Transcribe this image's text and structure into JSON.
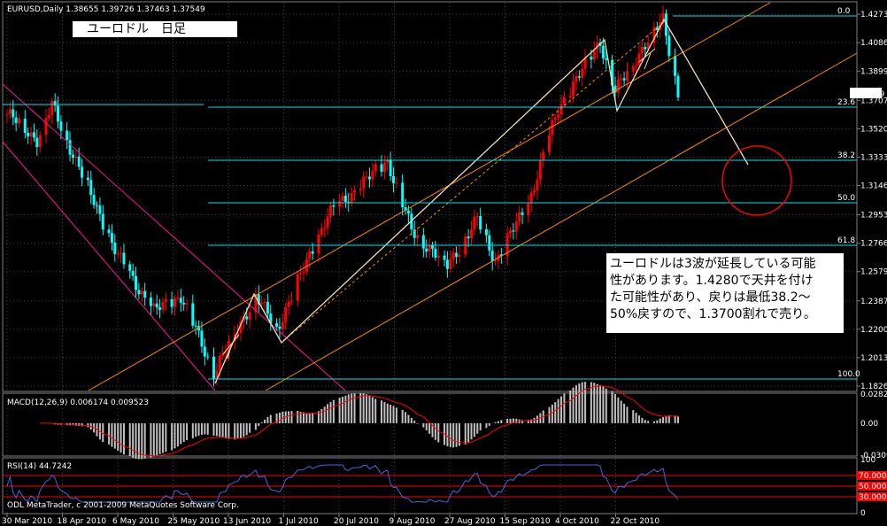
{
  "header": {
    "symbol_line": "EURUSD,Daily  1.38655 1.39726 1.37463 1.37549",
    "overlay_title": "ユーロドル　日足"
  },
  "annotation": {
    "lines": [
      "ユーロドルは3波が延長している可能",
      "性があります。1.4280で天井を付け",
      "た可能性があり、戻りは最低38.2〜",
      "50%戻すので、1.3700割れで売り。"
    ]
  },
  "price_axis": {
    "ticks": [
      "1.42735",
      "1.40865",
      "1.38995",
      "1.37070",
      "1.35200",
      "1.33330",
      "1.31460",
      "1.29535",
      "1.27665",
      "1.25795",
      "1.23870",
      "1.22000",
      "1.20130",
      "1.18260"
    ],
    "current_price": "1.37549"
  },
  "fibonacci": {
    "levels": [
      "0.0",
      "23.6",
      "38.2",
      "50.0",
      "61.8",
      "100.0"
    ]
  },
  "macd": {
    "label": "MACD(12,26,9) 0.006174 0.009523",
    "ticks": [
      "0.02829",
      "0.00",
      "-0.03097"
    ]
  },
  "rsi": {
    "label": "RSI(14) 44.7242",
    "ticks": [
      "100",
      "70.0000",
      "50.0000",
      "30.0000",
      "0"
    ]
  },
  "footer": {
    "copyright": "ODL MetaTrader, c 2001-2009 MetaQuotes Software Corp."
  },
  "time_axis": {
    "ticks": [
      "30 Mar 2010",
      "18 Apr 2010",
      "6 May 2010",
      "25 May 2010",
      "13 Jun 2010",
      "1 Jul 2010",
      "20 Jul 2010",
      "9 Aug 2010",
      "27 Aug 2010",
      "15 Sep 2010",
      "4 Oct 2010",
      "22 Oct 2010"
    ]
  },
  "colors": {
    "bull": "#ff0000",
    "bear": "#00ffff",
    "grid": "#2f4f4f",
    "fib": "#00e5ee",
    "macd_hist": "#c0c0c0",
    "macd_signal": "#ff0000",
    "rsi_line": "#4169e1",
    "rsi_levels": "#ff0000",
    "channel": "#ff8c00",
    "wave": "#f5deb3",
    "down_channel": "#ff1493"
  },
  "chart_data": {
    "type": "candlestick",
    "title": "EURUSD,Daily",
    "price_range": [
      1.1826,
      1.4274
    ],
    "anchors": [
      [
        "2010-03-30",
        1.362
      ],
      [
        "2010-04-09",
        1.345
      ],
      [
        "2010-04-14",
        1.367
      ],
      [
        "2010-04-22",
        1.331
      ],
      [
        "2010-05-06",
        1.268
      ],
      [
        "2010-05-18",
        1.232
      ],
      [
        "2010-05-27",
        1.242
      ],
      [
        "2010-06-07",
        1.192
      ],
      [
        "2010-06-21",
        1.242
      ],
      [
        "2010-06-28",
        1.22
      ],
      [
        "2010-07-15",
        1.295
      ],
      [
        "2010-08-04",
        1.331
      ],
      [
        "2010-08-12",
        1.285
      ],
      [
        "2010-08-24",
        1.262
      ],
      [
        "2010-09-03",
        1.292
      ],
      [
        "2010-09-09",
        1.265
      ],
      [
        "2010-09-20",
        1.303
      ],
      [
        "2010-09-30",
        1.365
      ],
      [
        "2010-10-14",
        1.41
      ],
      [
        "2010-10-19",
        1.376
      ],
      [
        "2010-10-26",
        1.399
      ],
      [
        "2010-11-04",
        1.424
      ],
      [
        "2010-11-09",
        1.376
      ]
    ],
    "x_ticks": [
      "30 Mar 2010",
      "18 Apr 2010",
      "6 May 2010",
      "25 May 2010",
      "13 Jun 2010",
      "1 Jul 2010",
      "20 Jul 2010",
      "9 Aug 2010",
      "27 Aug 2010",
      "15 Sep 2010",
      "4 Oct 2010",
      "22 Oct 2010"
    ],
    "macd": {
      "value": 0.006174,
      "signal": 0.009523,
      "range": [
        -0.03097,
        0.02829
      ]
    },
    "rsi": {
      "value": 44.7242,
      "levels": [
        70,
        50,
        30
      ]
    },
    "fib_levels": [
      0.0,
      23.6,
      38.2,
      50.0,
      61.8,
      100.0
    ]
  }
}
